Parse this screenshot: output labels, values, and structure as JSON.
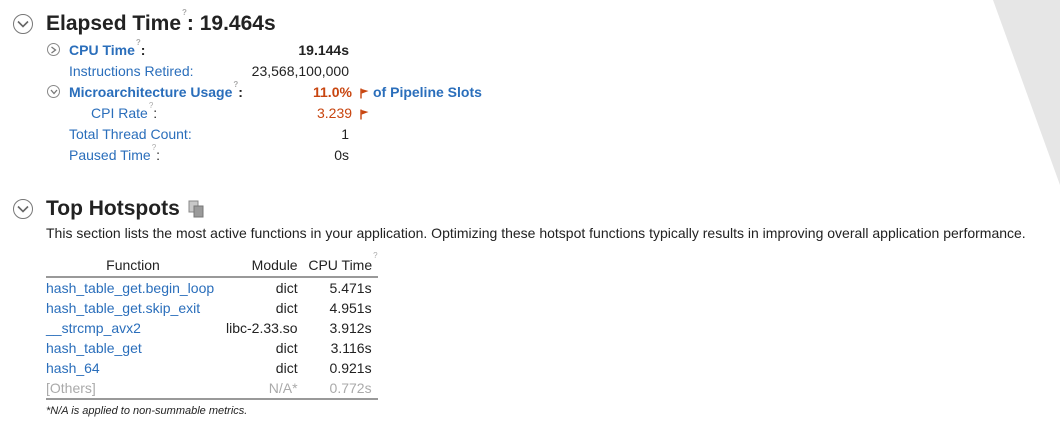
{
  "elapsed": {
    "title": "Elapsed Time",
    "value_text": ": 19.464s",
    "help_glyph": "?"
  },
  "metrics": {
    "cpu_time": {
      "label": "CPU Time",
      "colon": ":",
      "value": "19.144s"
    },
    "instructions_retired": {
      "label": "Instructions Retired:",
      "value": "23,568,100,000"
    },
    "microarch_usage": {
      "label": "Microarchitecture Usage",
      "colon": ":",
      "value": "11.0%",
      "suffix": "of Pipeline Slots"
    },
    "cpi_rate": {
      "label": "CPI Rate",
      "colon": ":",
      "value": "3.239"
    },
    "total_thread_count": {
      "label": "Total Thread Count:",
      "value": "1"
    },
    "paused_time": {
      "label": "Paused Time",
      "colon": ":",
      "value": "0s"
    }
  },
  "hotspots": {
    "title": "Top Hotspots",
    "description": "This section lists the most active functions in your application. Optimizing these hotspot functions typically results in improving overall application performance.",
    "columns": {
      "function": "Function",
      "module": "Module",
      "cpu_time": "CPU Time"
    },
    "rows": [
      {
        "function": "hash_table_get.begin_loop",
        "module": "dict",
        "cpu_time": "5.471s"
      },
      {
        "function": "hash_table_get.skip_exit",
        "module": "dict",
        "cpu_time": "4.951s"
      },
      {
        "function": "__strcmp_avx2",
        "module": "libc-2.33.so",
        "cpu_time": "3.912s"
      },
      {
        "function": "hash_table_get",
        "module": "dict",
        "cpu_time": "3.116s"
      },
      {
        "function": "hash_64",
        "module": "dict",
        "cpu_time": "0.921s"
      },
      {
        "function": "[Others]",
        "module": "N/A*",
        "cpu_time": "0.772s"
      }
    ],
    "footnote": "*N/A is applied to non-summable metrics."
  },
  "colors": {
    "link": "#2a6ebb",
    "issue": "#c8450f",
    "muted": "#aaaaaa"
  }
}
